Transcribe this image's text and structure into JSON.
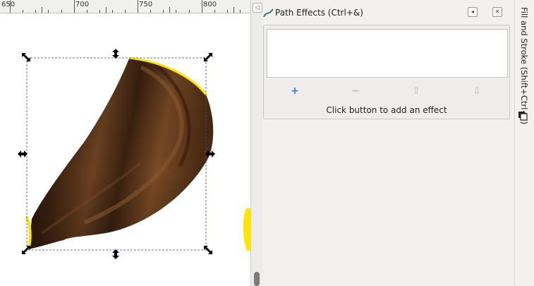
{
  "ruler": {
    "labels": [
      "650",
      "700",
      "750",
      "800"
    ]
  },
  "panel": {
    "title": "Path Effects (Ctrl+&)",
    "hint": "Click button to add an effect",
    "buttons": {
      "add": "+",
      "remove": "−",
      "up": "⇧",
      "down": "⇩"
    }
  },
  "side_tab": {
    "label": "Fill and Stroke (Shift+Ctrl+F)"
  },
  "colors": {
    "selection_outline": "#ffe600",
    "shape_dark": "#2b160a",
    "shape_mid": "#6b4122",
    "add_icon": "#3a78c8",
    "disabled_icon": "#bcbcbc"
  }
}
